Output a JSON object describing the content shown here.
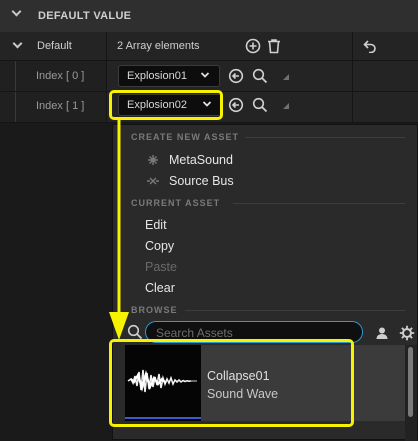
{
  "section": {
    "title": "DEFAULT VALUE"
  },
  "rows": {
    "default": {
      "label": "Default",
      "value": "2 Array elements"
    },
    "index0": {
      "label": "Index [ 0 ]",
      "value": "Explosion01"
    },
    "index1": {
      "label": "Index [ 1 ]",
      "value": "Explosion02"
    }
  },
  "menu": {
    "create_header": "CREATE NEW ASSET",
    "create_items": [
      "MetaSound",
      "Source Bus"
    ],
    "current_header": "CURRENT ASSET",
    "edit": "Edit",
    "copy": "Copy",
    "paste": "Paste",
    "clear": "Clear",
    "browse_header": "BROWSE",
    "search_placeholder": "Search Assets"
  },
  "asset": {
    "name": "Collapse01",
    "type": "Sound Wave"
  },
  "colors": {
    "highlight": "#f7f200",
    "search_focus": "#2b9bd6",
    "thumb_bar": "#3a5bd0"
  },
  "icons": [
    "chevron-down-icon",
    "add-icon",
    "trash-icon",
    "reset-icon",
    "use-selected-icon",
    "search-icon",
    "person-icon",
    "settings-icon",
    "metasound-icon",
    "source-bus-icon"
  ]
}
